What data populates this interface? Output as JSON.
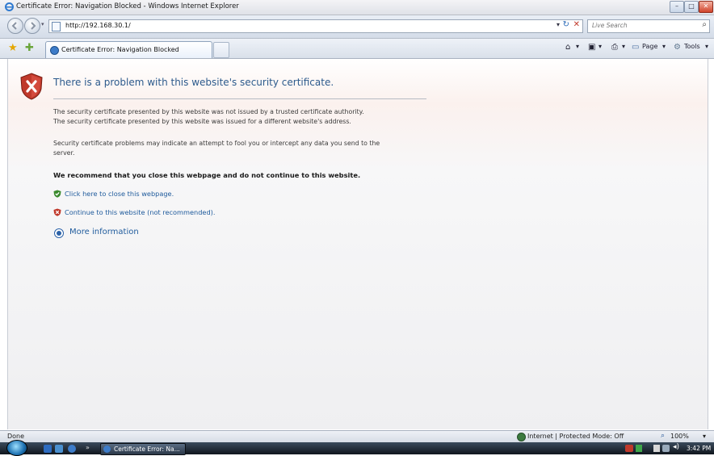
{
  "window": {
    "title": "Certificate Error: Navigation Blocked - Windows Internet Explorer"
  },
  "toolbar": {
    "address_url": "http://192.168.30.1/",
    "search_placeholder": "Live Search"
  },
  "tabs": [
    {
      "label": "Certificate Error: Navigation Blocked",
      "active": true
    }
  ],
  "command_bar": {
    "page_label": "Page",
    "tools_label": "Tools"
  },
  "content": {
    "heading": "There is a problem with this website's security certificate.",
    "paragraph1_line1": "The security certificate presented by this website was not issued by a trusted certificate authority.",
    "paragraph1_line2": "The security certificate presented by this website was issued for a different website's address.",
    "paragraph2_line1": "Security certificate problems may indicate an attempt to fool you or intercept any data you send to the",
    "paragraph2_line2": "server.",
    "recommendation": "We recommend that you close this webpage and do not continue to this website.",
    "close_link": "Click here to close this webpage.",
    "continue_link": "Continue to this website (not recommended).",
    "more_info": "More information"
  },
  "status": {
    "left_text": "Done",
    "zone_text": "Internet | Protected Mode: Off",
    "zoom_text": "100%"
  },
  "taskbar": {
    "task_label": "Certificate Error: Na...",
    "clock": "3:42 PM"
  },
  "colors": {
    "link": "#1f5b9c",
    "heading": "#2c5a8c",
    "shield_red": "#c0392b",
    "shield_green": "#3a8a2e"
  }
}
